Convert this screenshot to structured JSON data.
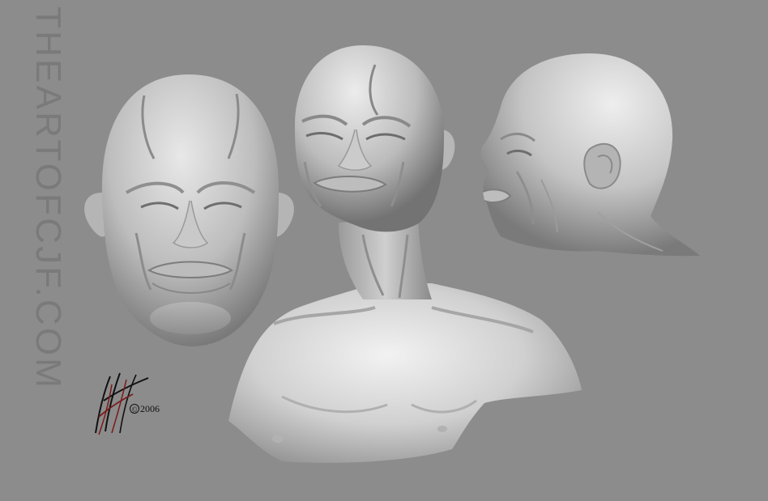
{
  "image": {
    "background_color": "#8c8c8c",
    "watermark": "THEARTOFCJF.COM",
    "copyright_year": "2006",
    "copyright_symbol": "©",
    "signature_color": "#7a1a1a",
    "sculpt_color": "#d8d8d8",
    "subjects": {
      "front_head": "front-view-head-sculpt",
      "bust": "three-quarter-bust-sculpt",
      "profile_head": "profile-view-head-sculpt"
    }
  }
}
